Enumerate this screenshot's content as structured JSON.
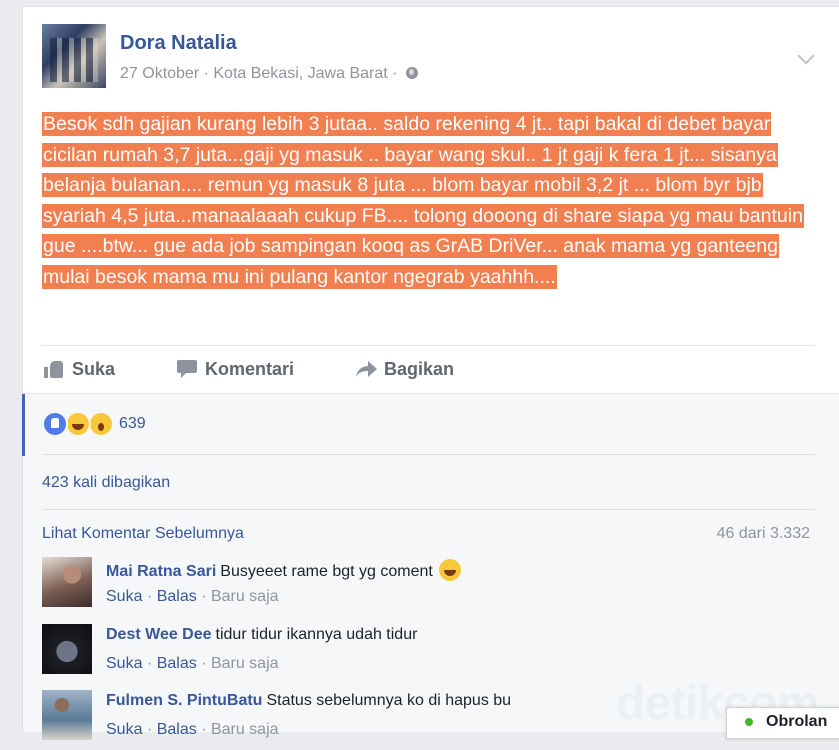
{
  "post": {
    "author": "Dora Natalia",
    "date": "27 Oktober",
    "separator_1": " · ",
    "location": "Kota Bekasi, Jawa Barat",
    "separator_2": " · ",
    "text": "Besok sdh gajian kurang lebih 3 jutaa.. saldo rekening 4 jt.. tapi bakal di debet bayar cicilan rumah 3,7 juta...gaji yg masuk .. bayar wang skul.. 1 jt gaji k fera 1 jt... sisanya belanja bulanan.... remun yg masuk 8 juta ... blom bayar mobil 3,2 jt ... blom byr bjb syariah 4,5 juta...manaalaaah cukup FB.... tolong dooong di share siapa yg mau bantuin gue ....btw... gue ada job sampingan kooq as GrAB DriVer... anak mama yg ganteeng mulai besok mama mu ini pulang kantor ngegrab yaahhh....",
    "text_highlight_color": "#f27f50"
  },
  "actions": {
    "like": "Suka",
    "comment": "Komentari",
    "share": "Bagikan"
  },
  "feedback": {
    "reaction_icons": [
      "like-reaction-icon",
      "haha-reaction-icon",
      "wow-reaction-icon"
    ],
    "reaction_count": "639",
    "shares": "423 kali dibagikan",
    "view_previous": "Lihat Komentar Sebelumnya",
    "counter": "46 dari 3.332"
  },
  "comments": [
    {
      "name": "Mai Ratna Sari",
      "text": "Busyeeet rame bgt yg coment",
      "like": "Suka",
      "dot": " · ",
      "reply": "Balas",
      "dot2": " · ",
      "time": "Baru saja"
    },
    {
      "name": "Dest Wee Dee",
      "text": "tidur tidur ikannya udah tidur",
      "like": "Suka",
      "dot": " · ",
      "reply": "Balas",
      "dot2": " · ",
      "time": "Baru saja"
    },
    {
      "name": "Fulmen S. PintuBatu",
      "text": "Status sebelumnya ko di hapus bu",
      "like": "Suka",
      "dot": " · ",
      "reply": "Balas",
      "dot2": " · ",
      "time": "Baru saja"
    }
  ],
  "watermark": "detikcom",
  "chat": {
    "label": "Obrolan"
  },
  "colors": {
    "link": "#365899",
    "accent": "#4267b2",
    "meta": "#90949c",
    "online": "#42b72a"
  }
}
